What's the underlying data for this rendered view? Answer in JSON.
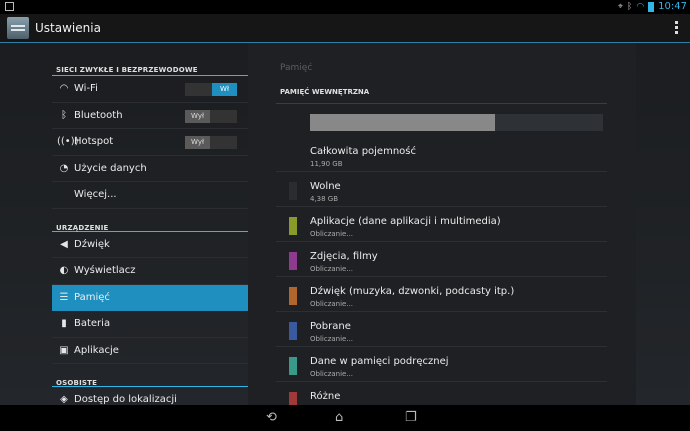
{
  "status": {
    "time": "10:47"
  },
  "actionbar": {
    "title": "Ustawienia"
  },
  "sidebar": {
    "sections": [
      {
        "header": "SIECI ZWYKŁE I BEZPRZEWODOWE"
      },
      {
        "header": "URZĄDZENIE"
      },
      {
        "header": "OSOBISTE"
      }
    ],
    "wireless": [
      {
        "label": "Wi-Fi",
        "icon": "wifi-icon",
        "toggle": "Wł"
      },
      {
        "label": "Bluetooth",
        "icon": "bluetooth-icon",
        "toggle": "Wył"
      },
      {
        "label": "Hotspot",
        "icon": "hotspot-icon",
        "toggle": "Wył"
      },
      {
        "label": "Użycie danych",
        "icon": "data-usage-icon"
      },
      {
        "label": "Więcej..."
      }
    ],
    "device": [
      {
        "label": "Dźwięk",
        "icon": "sound-icon"
      },
      {
        "label": "Wyświetlacz",
        "icon": "display-icon"
      },
      {
        "label": "Pamięć",
        "icon": "storage-icon",
        "selected": true
      },
      {
        "label": "Bateria",
        "icon": "battery-icon"
      },
      {
        "label": "Aplikacje",
        "icon": "apps-icon"
      }
    ],
    "personal": [
      {
        "label": "Dostęp do lokalizacji",
        "icon": "location-icon"
      }
    ]
  },
  "main": {
    "title": "Pamięć",
    "section": "PAMIĘĆ WEWNĘTRZNA",
    "usage_fraction": 0.63,
    "items": [
      {
        "title": "Całkowita pojemność",
        "sub": "11,90 GB",
        "color": ""
      },
      {
        "title": "Wolne",
        "sub": "4,38 GB",
        "color": "#2a2c2f"
      },
      {
        "title": "Aplikacje (dane aplikacji i multimedia)",
        "sub": "Obliczanie...",
        "color": "#8a9a2a"
      },
      {
        "title": "Zdjęcia, filmy",
        "sub": "Obliczanie...",
        "color": "#8e3a8e"
      },
      {
        "title": "Dźwięk (muzyka, dzwonki, podcasty itp.)",
        "sub": "Obliczanie...",
        "color": "#b0662c"
      },
      {
        "title": "Pobrane",
        "sub": "Obliczanie...",
        "color": "#3a5aa0"
      },
      {
        "title": "Dane w pamięci podręcznej",
        "sub": "Obliczanie...",
        "color": "#3a9a8a"
      },
      {
        "title": "Różne",
        "sub": "",
        "color": "#a03a3a"
      }
    ]
  }
}
